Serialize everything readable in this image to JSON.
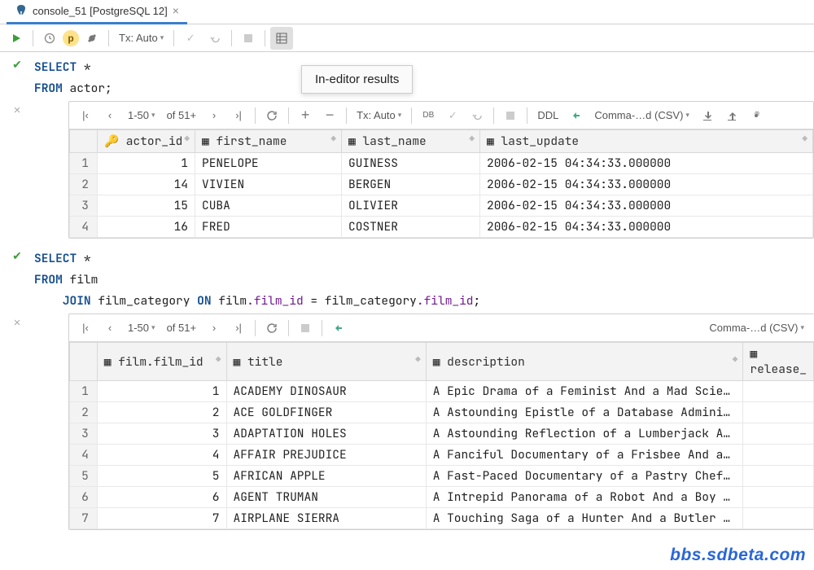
{
  "tab": {
    "title": "console_51 [PostgreSQL 12]"
  },
  "toolbar": {
    "tx_label": "Tx: Auto"
  },
  "tooltip": "In-editor results",
  "query1": {
    "lines": [
      "SELECT *",
      "FROM actor;"
    ],
    "pager": {
      "range": "1-50",
      "of": "of 51+"
    },
    "result_tb": {
      "tx": "Tx: Auto",
      "db": "DB",
      "ddl": "DDL",
      "format": "Comma-…d (CSV)"
    },
    "cols": [
      "actor_id",
      "first_name",
      "last_name",
      "last_update"
    ],
    "rows": [
      {
        "n": "1",
        "actor_id": "1",
        "first_name": "PENELOPE",
        "last_name": "GUINESS",
        "last_update": "2006-02-15 04:34:33.000000"
      },
      {
        "n": "2",
        "actor_id": "14",
        "first_name": "VIVIEN",
        "last_name": "BERGEN",
        "last_update": "2006-02-15 04:34:33.000000"
      },
      {
        "n": "3",
        "actor_id": "15",
        "first_name": "CUBA",
        "last_name": "OLIVIER",
        "last_update": "2006-02-15 04:34:33.000000"
      },
      {
        "n": "4",
        "actor_id": "16",
        "first_name": "FRED",
        "last_name": "COSTNER",
        "last_update": "2006-02-15 04:34:33.000000"
      }
    ]
  },
  "query2": {
    "lines": [
      "SELECT *",
      "FROM film",
      "    JOIN film_category ON film.film_id = film_category.film_id;"
    ],
    "pager": {
      "range": "1-50",
      "of": "of 51+"
    },
    "result_tb": {
      "format": "Comma-…d (CSV)"
    },
    "cols": [
      "film.film_id",
      "title",
      "description",
      "release_"
    ],
    "rows": [
      {
        "n": "1",
        "id": "1",
        "title": "ACADEMY DINOSAUR",
        "desc": "A Epic Drama of a Feminist And a Mad Scien…"
      },
      {
        "n": "2",
        "id": "2",
        "title": "ACE GOLDFINGER",
        "desc": "A Astounding Epistle of a Database Adminis…"
      },
      {
        "n": "3",
        "id": "3",
        "title": "ADAPTATION HOLES",
        "desc": "A Astounding Reflection of a Lumberjack An…"
      },
      {
        "n": "4",
        "id": "4",
        "title": "AFFAIR PREJUDICE",
        "desc": "A Fanciful Documentary of a Frisbee And a …"
      },
      {
        "n": "5",
        "id": "5",
        "title": "AFRICAN APPLE",
        "desc": "A Fast-Paced Documentary of a Pastry Chef …"
      },
      {
        "n": "6",
        "id": "6",
        "title": "AGENT TRUMAN",
        "desc": "A Intrepid Panorama of a Robot And a Boy w…"
      },
      {
        "n": "7",
        "id": "7",
        "title": "AIRPLANE SIERRA",
        "desc": "A Touching Saga of a Hunter And a Butler w…"
      }
    ]
  },
  "watermark": "bbs.sdbeta.com"
}
